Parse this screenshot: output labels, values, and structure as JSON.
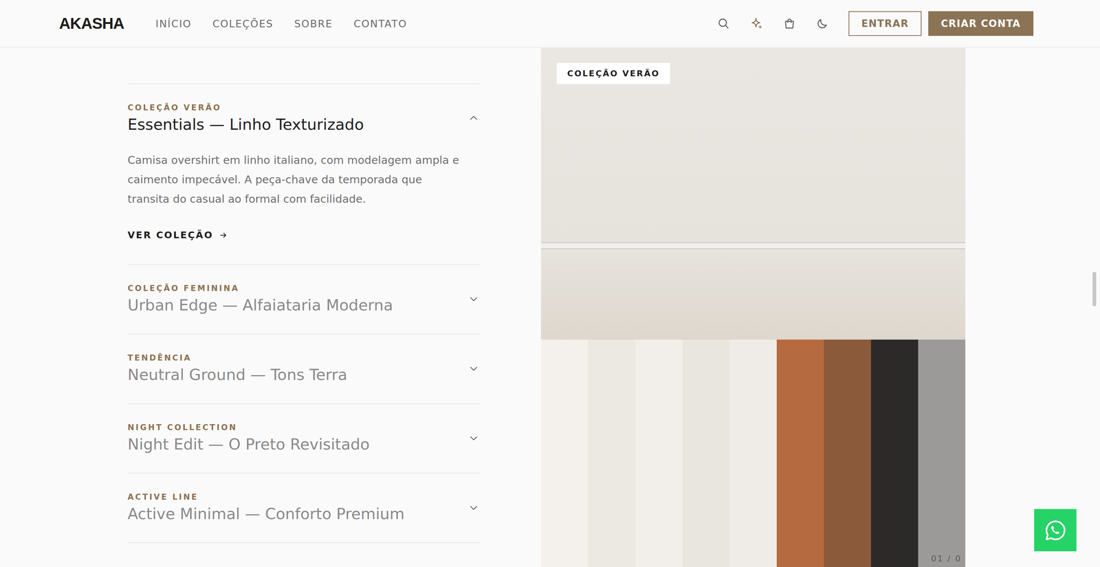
{
  "brand": "AKASHA",
  "nav": [
    {
      "label": "INÍCIO"
    },
    {
      "label": "COLEÇÕES"
    },
    {
      "label": "SOBRE"
    },
    {
      "label": "CONTATO"
    }
  ],
  "header_actions": {
    "login": "ENTRAR",
    "signup": "CRIAR CONTA"
  },
  "accordion": [
    {
      "category": "COLEÇÃO VERÃO",
      "title": "Essentials — Linho Texturizado",
      "expanded": true,
      "description": "Camisa overshirt em linho italiano, com modelagem ampla e caimento impecável. A peça-chave da temporada que transita do casual ao formal com facilidade.",
      "link": "VER COLEÇÃO"
    },
    {
      "category": "COLEÇÃO FEMININA",
      "title": "Urban Edge — Alfaiataria Moderna",
      "expanded": false
    },
    {
      "category": "TENDÊNCIA",
      "title": "Neutral Ground — Tons Terra",
      "expanded": false
    },
    {
      "category": "NIGHT COLLECTION",
      "title": "Night Edit — O Preto Revisitado",
      "expanded": false
    },
    {
      "category": "ACTIVE LINE",
      "title": "Active Minimal — Conforto Premium",
      "expanded": false
    }
  ],
  "gallery": {
    "badge": "COLEÇÃO VERÃO",
    "counter": "01 / 0"
  }
}
